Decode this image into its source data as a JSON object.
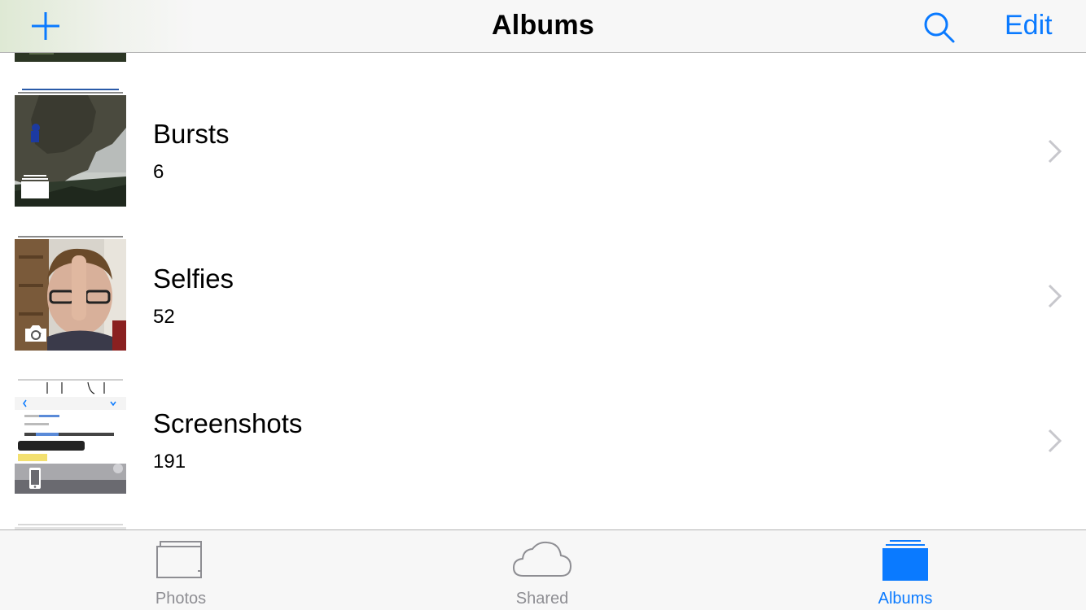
{
  "navbar": {
    "title": "Albums",
    "edit_label": "Edit"
  },
  "albums": [
    {
      "title": "Bursts",
      "count": "6"
    },
    {
      "title": "Selfies",
      "count": "52"
    },
    {
      "title": "Screenshots",
      "count": "191"
    }
  ],
  "tabbar": {
    "tabs": [
      {
        "label": "Photos",
        "active": false
      },
      {
        "label": "Shared",
        "active": false
      },
      {
        "label": "Albums",
        "active": true
      }
    ]
  },
  "colors": {
    "accent": "#0a7aff",
    "inactive_tab": "#8e8e93",
    "bar_background": "#f7f7f7"
  },
  "icons": {
    "add": "plus-icon",
    "search": "search-icon",
    "chevron": "chevron-right-icon",
    "burst_badge": "burst-icon",
    "selfie_badge": "front-camera-icon",
    "screenshot_badge": "iphone-icon",
    "photos_tab": "photos-stack-icon",
    "shared_tab": "cloud-icon",
    "albums_tab": "albums-stack-icon"
  }
}
